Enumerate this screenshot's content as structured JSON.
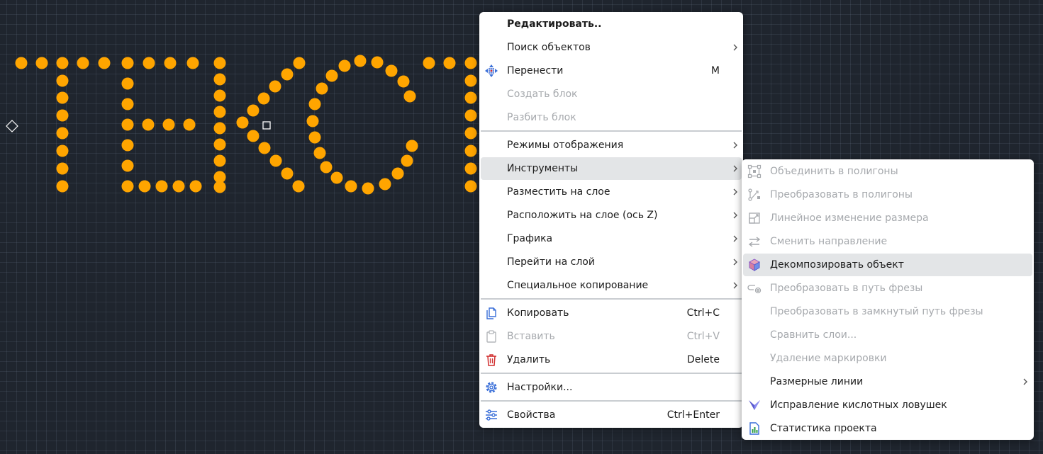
{
  "canvas": {
    "text_art_color": "#ffa500",
    "grid_color": "#2c3440",
    "background_color": "#1f252e"
  },
  "main_menu": {
    "items": [
      {
        "label": "Редактировать..",
        "bold": true
      },
      {
        "label": "Поиск объектов",
        "submenu": true
      },
      {
        "label": "Перенести",
        "shortcut": "M",
        "icon": "move-icon"
      },
      {
        "label": "Создать блок",
        "disabled": true
      },
      {
        "label": "Разбить блок",
        "disabled": true
      },
      {
        "label": "Режимы отображения",
        "submenu": true
      },
      {
        "label": "Инструменты",
        "submenu": true,
        "highlighted": true
      },
      {
        "label": "Разместить на слое",
        "submenu": true
      },
      {
        "label": "Расположить на слое (ось Z)",
        "submenu": true
      },
      {
        "label": "Графика",
        "submenu": true
      },
      {
        "label": "Перейти на слой",
        "submenu": true
      },
      {
        "label": "Специальное копирование",
        "submenu": true
      },
      {
        "label": "Копировать",
        "shortcut": "Ctrl+C",
        "icon": "copy-icon"
      },
      {
        "label": "Вставить",
        "shortcut": "Ctrl+V",
        "icon": "paste-icon",
        "disabled": true
      },
      {
        "label": "Удалить",
        "shortcut": "Delete",
        "icon": "delete-icon"
      },
      {
        "label": "Настройки...",
        "icon": "settings-icon"
      },
      {
        "label": "Свойства",
        "shortcut": "Ctrl+Enter",
        "icon": "properties-icon"
      }
    ]
  },
  "tools_submenu": {
    "items": [
      {
        "label": "Объединить в полигоны",
        "disabled": true,
        "icon": "merge-polygons-icon"
      },
      {
        "label": "Преобразовать в полигоны",
        "disabled": true,
        "icon": "convert-polygons-icon"
      },
      {
        "label": "Линейное изменение размера",
        "disabled": true,
        "icon": "resize-icon"
      },
      {
        "label": "Сменить направление",
        "disabled": true,
        "icon": "swap-direction-icon"
      },
      {
        "label": "Декомпозировать объект",
        "highlighted": true,
        "icon": "decompose-cube-icon"
      },
      {
        "label": "Преобразовать в путь фрезы",
        "disabled": true,
        "icon": "mill-path-icon"
      },
      {
        "label": "Преобразовать в замкнутый путь фрезы",
        "disabled": true
      },
      {
        "label": "Сравнить слои...",
        "disabled": true
      },
      {
        "label": "Удаление маркировки",
        "disabled": true
      },
      {
        "label": "Размерные линии",
        "submenu": true
      },
      {
        "label": "Исправление кислотных ловушек",
        "icon": "acid-trap-icon"
      },
      {
        "label": "Статистика проекта",
        "icon": "statistics-icon"
      }
    ]
  }
}
